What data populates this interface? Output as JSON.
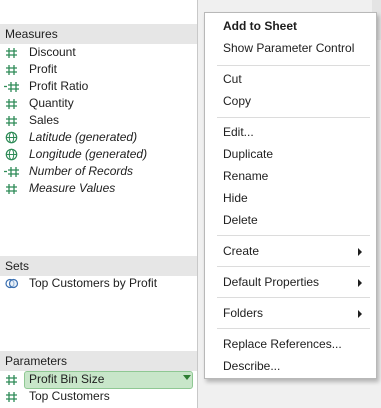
{
  "sections": {
    "measures": {
      "title": "Measures",
      "items": [
        {
          "label": "Discount",
          "icon": "hash-icon",
          "italic": false
        },
        {
          "label": "Profit",
          "icon": "hash-icon",
          "italic": false
        },
        {
          "label": "Profit Ratio",
          "icon": "calculated-hash-icon",
          "italic": false
        },
        {
          "label": "Quantity",
          "icon": "hash-icon",
          "italic": false
        },
        {
          "label": "Sales",
          "icon": "hash-icon",
          "italic": false
        },
        {
          "label": "Latitude (generated)",
          "icon": "globe-icon",
          "italic": true
        },
        {
          "label": "Longitude (generated)",
          "icon": "globe-icon",
          "italic": true
        },
        {
          "label": "Number of Records",
          "icon": "calculated-hash-icon",
          "italic": true
        },
        {
          "label": "Measure Values",
          "icon": "hash-icon",
          "italic": true
        }
      ]
    },
    "sets": {
      "title": "Sets",
      "items": [
        {
          "label": "Top Customers by Profit",
          "icon": "set-icon"
        }
      ]
    },
    "parameters": {
      "title": "Parameters",
      "items": [
        {
          "label": "Profit Bin Size",
          "icon": "hash-icon",
          "selected": true
        },
        {
          "label": "Top Customers",
          "icon": "hash-icon",
          "selected": false
        }
      ]
    }
  },
  "context_menu": {
    "items": [
      {
        "label": "Add to Sheet",
        "bold": true
      },
      {
        "label": "Show Parameter Control"
      },
      {
        "label": "Cut"
      },
      {
        "label": "Copy"
      },
      {
        "label": "Edit..."
      },
      {
        "label": "Duplicate"
      },
      {
        "label": "Rename"
      },
      {
        "label": "Hide"
      },
      {
        "label": "Delete"
      },
      {
        "label": "Create",
        "submenu": true
      },
      {
        "label": "Default Properties",
        "submenu": true
      },
      {
        "label": "Folders",
        "submenu": true
      },
      {
        "label": "Replace References..."
      },
      {
        "label": "Describe..."
      }
    ]
  },
  "colors": {
    "measure_icon": "#2e8b57",
    "set_icon": "#3a6fb0",
    "selected_bg": "#c8e6c9",
    "section_header_bg": "#e6e6e6"
  }
}
